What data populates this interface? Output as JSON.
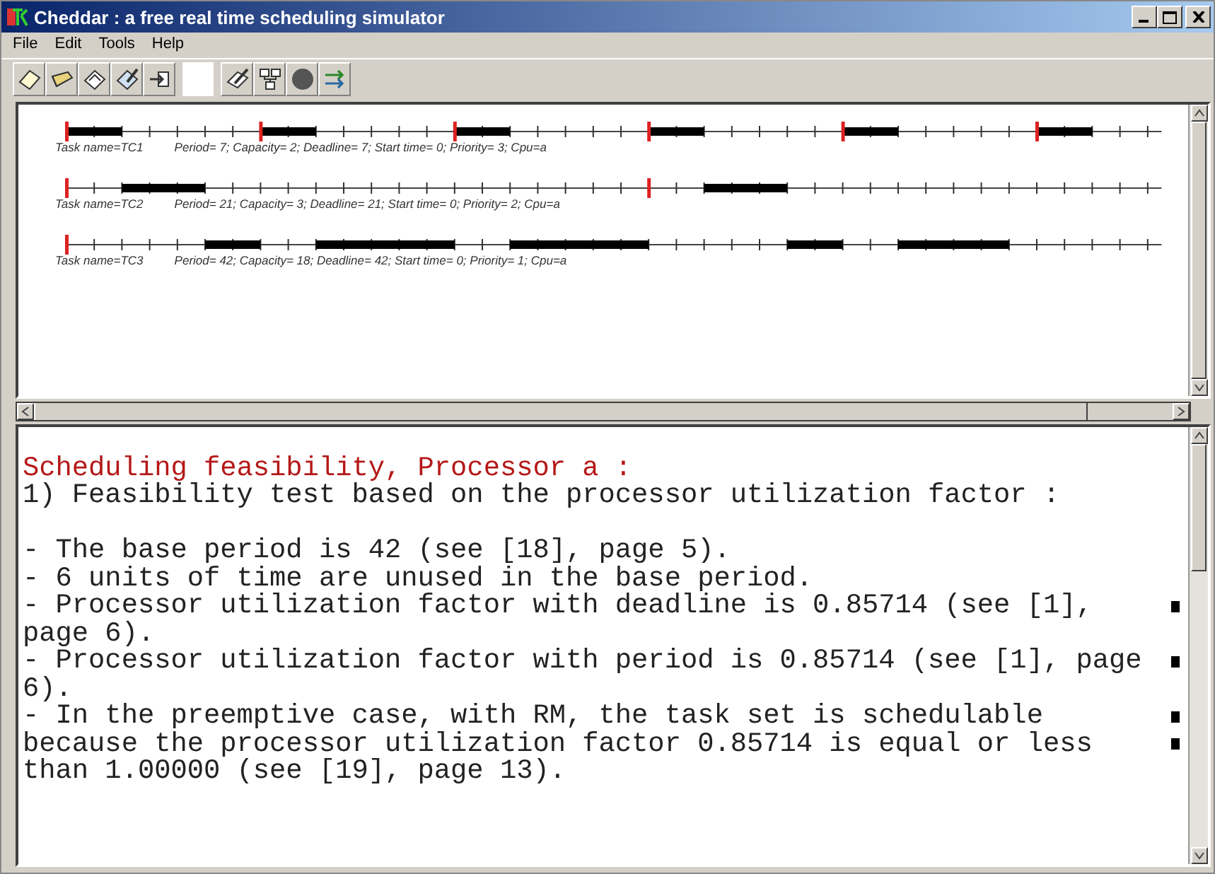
{
  "window": {
    "title": "Cheddar : a free real time scheduling simulator"
  },
  "menu": [
    "File",
    "Edit",
    "Tools",
    "Help"
  ],
  "timelines": [
    {
      "task": "Task name=TC1",
      "params": "Period= 7; Capacity= 2; Deadline= 7; Start time= 0; Priority= 3; Cpu=a"
    },
    {
      "task": "Task name=TC2",
      "params": "Period= 21; Capacity= 3; Deadline= 21; Start time= 0; Priority= 2; Cpu=a"
    },
    {
      "task": "Task name=TC3",
      "params": "Period= 42; Capacity= 18; Deadline= 42; Start time= 0; Priority= 1; Cpu=a"
    }
  ],
  "output": [
    {
      "kind": "heading",
      "text": "Scheduling feasibility, Processor a :",
      "space_before": true,
      "wrapped": false
    },
    {
      "kind": "text",
      "text": "1) Feasibility test based on the processor utilization factor :",
      "space_before": false,
      "wrapped": false
    },
    {
      "kind": "text",
      "text": "- The base period is 42 (see [18], page 5).",
      "space_before": true,
      "wrapped": false
    },
    {
      "kind": "text",
      "text": "- 6 units of time are unused in the base period.",
      "space_before": false,
      "wrapped": false
    },
    {
      "kind": "text",
      "text": "- Processor utilization factor with deadline is 0.85714 (see [1],",
      "space_before": false,
      "wrapped": true
    },
    {
      "kind": "text",
      "text": "page 6).",
      "space_before": false,
      "wrapped": false
    },
    {
      "kind": "text",
      "text": "- Processor utilization factor with period is 0.85714 (see [1], page",
      "space_before": false,
      "wrapped": true
    },
    {
      "kind": "text",
      "text": "6).",
      "space_before": false,
      "wrapped": false
    },
    {
      "kind": "text",
      "text": "- In the preemptive case, with RM, the task set is schedulable",
      "space_before": false,
      "wrapped": true
    },
    {
      "kind": "text",
      "text": "because the processor utilization factor 0.85714 is equal or less",
      "space_before": false,
      "wrapped": true
    },
    {
      "kind": "text",
      "text": "than 1.00000 (see [19], page 13).",
      "space_before": false,
      "wrapped": false
    }
  ]
}
